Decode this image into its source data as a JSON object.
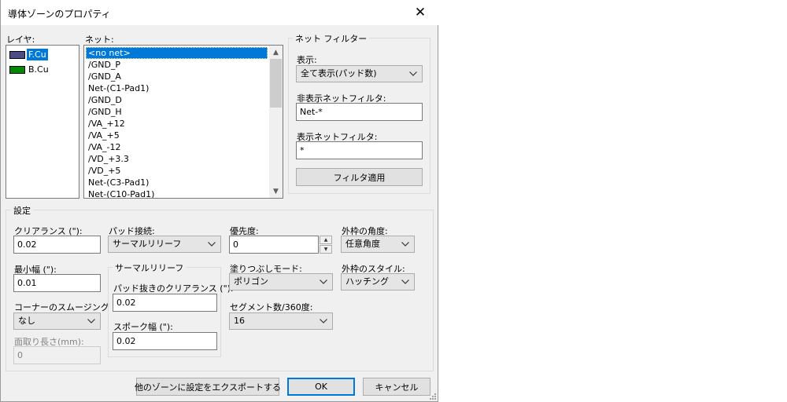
{
  "window": {
    "title": "導体ゾーンのプロパティ"
  },
  "layers": {
    "label": "レイヤ:",
    "items": [
      {
        "name": "F.Cu",
        "color": "#4c4c86",
        "selected": true
      },
      {
        "name": "B.Cu",
        "color": "#008a00",
        "selected": false
      }
    ]
  },
  "nets": {
    "label": "ネット:",
    "items": [
      "<no net>",
      "/GND_P",
      "/GND_A",
      "Net-(C1-Pad1)",
      "/GND_D",
      "/GND_H",
      "/VA_+12",
      "/VA_+5",
      "/VA_-12",
      "/VD_+3.3",
      "/VD_+5",
      "Net-(C3-Pad1)",
      "Net-(C10-Pad1)"
    ]
  },
  "net_filter": {
    "group_title": "ネット フィルター",
    "show_label": "表示:",
    "show_value": "全て表示(パッド数)",
    "hide_filter_label": "非表示ネットフィルタ:",
    "hide_filter_value": "Net-*",
    "show_filter_label": "表示ネットフィルタ:",
    "show_filter_value": "*",
    "apply_button": "フィルタ適用"
  },
  "settings": {
    "group_title": "設定",
    "clearance_label": "クリアランス (\"):",
    "clearance_value": "0.02",
    "min_width_label": "最小幅 (\"):",
    "min_width_value": "0.01",
    "corner_label": "コーナーのスムージング",
    "corner_value": "なし",
    "chamfer_label": "面取り長さ(mm):",
    "chamfer_value": "0",
    "pad_conn_label": "パッド接続:",
    "pad_conn_value": "サーマルリリーフ",
    "thermal_group_title": "サーマルリリーフ",
    "antipad_label": "パッド抜きのクリアランス (\"):",
    "antipad_value": "0.02",
    "spoke_label": "スポーク幅 (\"):",
    "spoke_value": "0.02",
    "priority_label": "優先度:",
    "priority_value": "0",
    "fill_mode_label": "塗りつぶしモード:",
    "fill_mode_value": "ポリゴン",
    "segments_label": "セグメント数/360度:",
    "segments_value": "16",
    "outline_angle_label": "外枠の角度:",
    "outline_angle_value": "任意角度",
    "outline_style_label": "外枠のスタイル:",
    "outline_style_value": "ハッチング"
  },
  "buttons": {
    "export": "他のゾーンに設定をエクスポートする",
    "ok": "OK",
    "cancel": "キャンセル"
  }
}
